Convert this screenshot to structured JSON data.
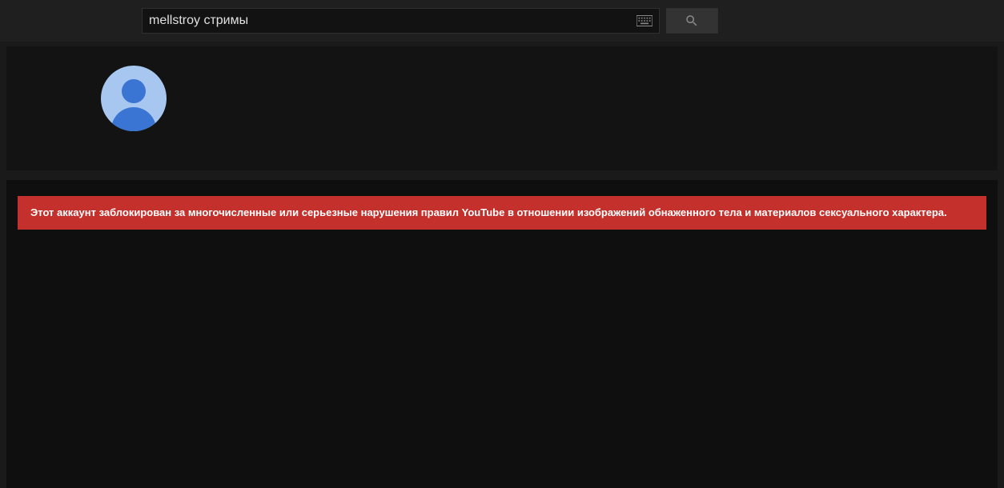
{
  "search": {
    "value": "mellstroy стримы"
  },
  "alert": {
    "message": "Этот аккаунт заблокирован за многочисленные или серьезные нарушения правил YouTube в отношении изображений обнаженного тела и материалов сексуального характера."
  }
}
